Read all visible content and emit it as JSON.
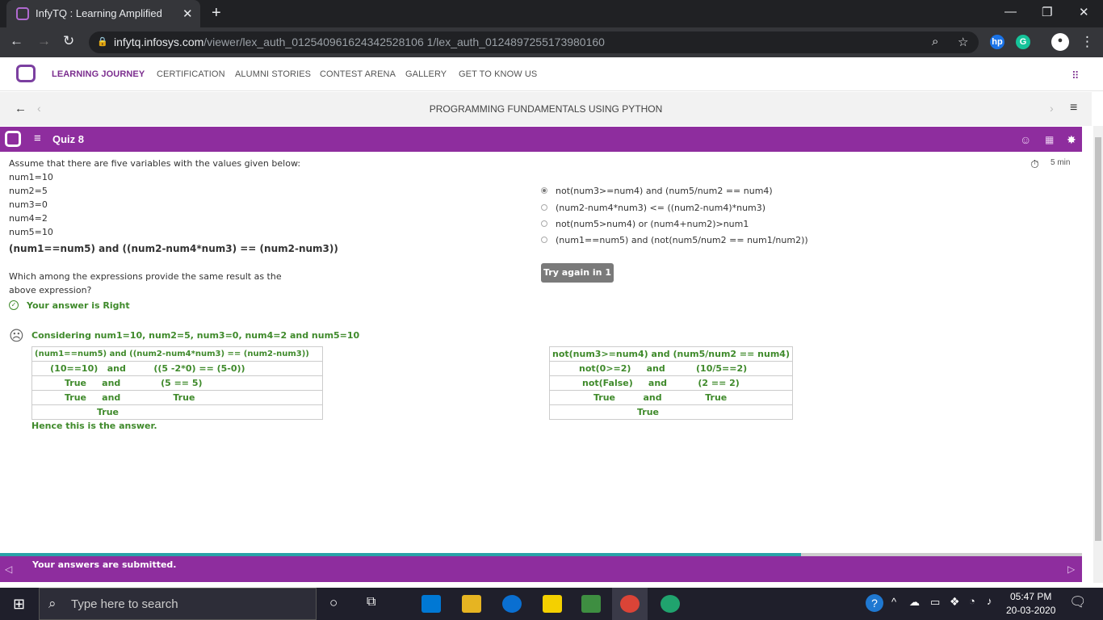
{
  "browser": {
    "tab_title": "InfyTQ : Learning Amplified",
    "close": "✕",
    "new_tab": "+",
    "url_domain": "infytq.infosys.com",
    "url_path": "/viewer/lex_auth_012540961624342528106 1/lex_auth_0124897255173980160",
    "ext_hp": "hp",
    "ext_g": "G"
  },
  "site_nav": {
    "items": [
      "LEARNING JOURNEY",
      "CERTIFICATION",
      "ALUMNI STORIES",
      "CONTEST ARENA",
      "GALLERY",
      "GET TO KNOW US"
    ]
  },
  "course": {
    "title": "PROGRAMMING FUNDAMENTALS USING PYTHON"
  },
  "quiz": {
    "title": "Quiz 8",
    "timer": "5 min",
    "question_intro": "Assume that there are five variables with the values given below:",
    "vars": [
      "num1=10",
      "num2=5",
      "num3=0",
      "num4=2",
      "num5=10"
    ],
    "expression": "(num1==num5) and ((num2-num4*num3) == (num2-num3))",
    "question_line1": "Which among the expressions provide the same result as the",
    "question_line2": "above expression?",
    "result": "Your answer is Right",
    "options": [
      "not(num3>=num4) and (num5/num2 == num4)",
      "(num2-num4*num3) <= ((num2-num4)*num3)",
      "not(num5>num4) or (num4+num2)>num1",
      "(num1==num5) and (not(num5/num2 == num1/num2))"
    ],
    "selected_option": 0,
    "try_again": "Try again in 1",
    "explanation_title": "Considering num1=10, num2=5, num3=0, num4=2 and num5=10",
    "left_table": [
      "(num1==num5) and ((num2-num4*num3) == (num2-num3))",
      "     (10==10)   and         ((5 -2*0) == (5-0))",
      "True     and             (5 == 5)",
      "True     and                 True",
      "True"
    ],
    "right_table": [
      "not(num3>=num4) and (num5/num2 == num4)",
      "not(0>=2)     and          (10/5==2)",
      "not(False)     and          (2 == 2)",
      "True         and              True",
      "True"
    ],
    "conclusion": "Hence this is the answer."
  },
  "footer": {
    "message": "Your answers are submitted.",
    "progress_fraction": 0.74
  },
  "taskbar": {
    "search_placeholder": "Type here to search",
    "time": "05:47 PM",
    "date": "20-03-2020"
  }
}
